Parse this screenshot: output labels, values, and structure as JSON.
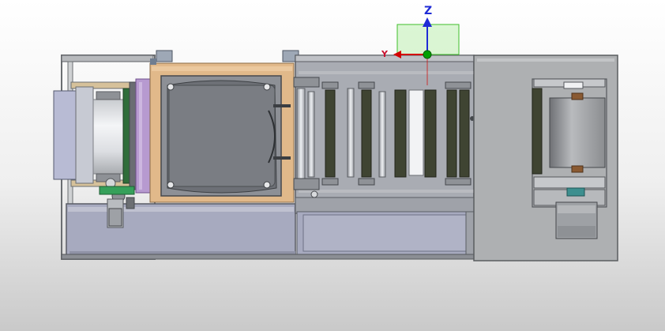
{
  "viewport": {
    "background_top": "#ffffff",
    "background_bottom": "#c9c9c9"
  },
  "triad": {
    "z_label": "Z",
    "y_label": "Y",
    "x_axis_color": "#d40000",
    "y_axis_color": "#00a000",
    "z_axis_color": "#1f2bd6",
    "plane_color": "#66dd44"
  },
  "model": {
    "frame_color": "#9a9da0",
    "panel_color": "#a9acb3",
    "base_color": "#a7aabf",
    "wood_color": "#e1b98a",
    "purple_color": "#b79ad0",
    "roller_dark": "#3f4432",
    "roller_light": "#e4e6ea",
    "right_cabinet_color": "#aeb0b2"
  }
}
